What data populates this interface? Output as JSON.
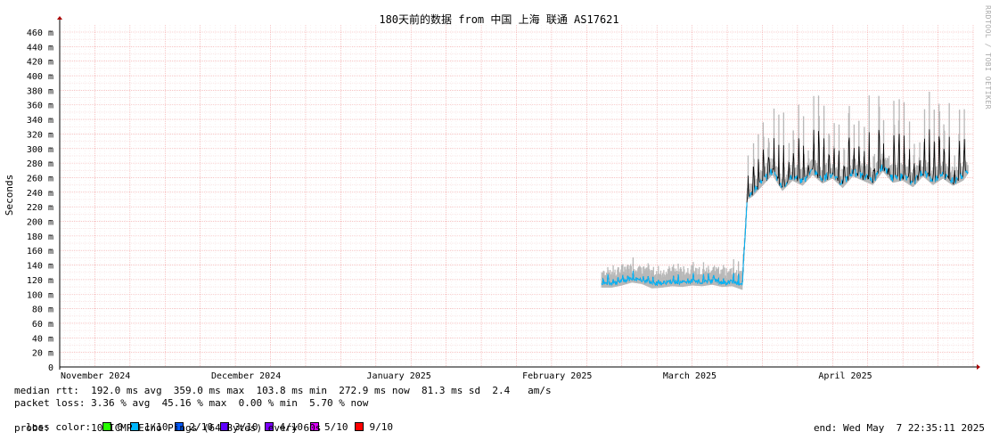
{
  "chart_data": {
    "type": "line",
    "title": "180天前的数据 from 中国 上海 联通 AS17621",
    "ylabel": "Seconds",
    "ylim": [
      0,
      460
    ],
    "yticks": [
      0,
      20,
      40,
      60,
      80,
      100,
      120,
      140,
      160,
      180,
      200,
      220,
      240,
      260,
      280,
      300,
      320,
      340,
      360,
      380,
      400,
      420,
      440,
      460
    ],
    "ytick_unit": "m",
    "xlabels": [
      "November 2024",
      "December 2024",
      "January 2025",
      "February 2025",
      "March 2025",
      "April 2025"
    ],
    "x_range_days": [
      0,
      182
    ],
    "xlabel_days": [
      0,
      30,
      61,
      92,
      120,
      151
    ],
    "series": [
      {
        "points": [
          [
            108,
            115
          ],
          [
            110,
            115
          ],
          [
            112,
            118
          ],
          [
            114,
            122
          ],
          [
            116,
            120
          ],
          [
            118,
            114
          ],
          [
            120,
            115
          ],
          [
            122,
            117
          ],
          [
            124,
            116
          ],
          [
            126,
            118
          ],
          [
            128,
            117
          ],
          [
            130,
            119
          ],
          [
            132,
            116
          ],
          [
            134,
            117
          ],
          [
            136,
            112
          ],
          [
            137,
            236
          ],
          [
            138,
            240
          ],
          [
            140,
            255
          ],
          [
            142,
            270
          ],
          [
            144,
            248
          ],
          [
            146,
            262
          ],
          [
            148,
            255
          ],
          [
            150,
            270
          ],
          [
            152,
            258
          ],
          [
            154,
            265
          ],
          [
            156,
            252
          ],
          [
            158,
            268
          ],
          [
            160,
            262
          ],
          [
            162,
            256
          ],
          [
            164,
            275
          ],
          [
            166,
            259
          ],
          [
            168,
            262
          ],
          [
            170,
            253
          ],
          [
            172,
            268
          ],
          [
            174,
            256
          ],
          [
            176,
            265
          ],
          [
            178,
            255
          ],
          [
            180,
            262
          ],
          [
            181,
            272
          ]
        ]
      }
    ],
    "grid": true
  },
  "stats": {
    "median_rtt": "median rtt:  192.0 ms avg  359.0 ms max  103.8 ms min  272.9 ms now  81.3 ms sd  2.4   am/s",
    "packet_loss": "packet loss: 3.36 % avg  45.16 % max  0.00 % min  5.70 % now",
    "loss_color_label": "loss color:",
    "loss_colors": [
      {
        "label": "0",
        "color": "#26ff00"
      },
      {
        "label": "1/10",
        "color": "#00b8ff"
      },
      {
        "label": "2/10",
        "color": "#0059ff"
      },
      {
        "label": "3/10",
        "color": "#5e00ff"
      },
      {
        "label": "4/10",
        "color": "#7e00ff"
      },
      {
        "label": "5/10",
        "color": "#dd00ff"
      },
      {
        "label": "9/10",
        "color": "#ff0000"
      }
    ],
    "probe": "probe:       10 ICMP Echo Pings (64 Bytes) every 60s",
    "end": "end: Wed May  7 22:35:11 2025"
  },
  "watermark": "RRDTOOL / TOBI OETIKER"
}
